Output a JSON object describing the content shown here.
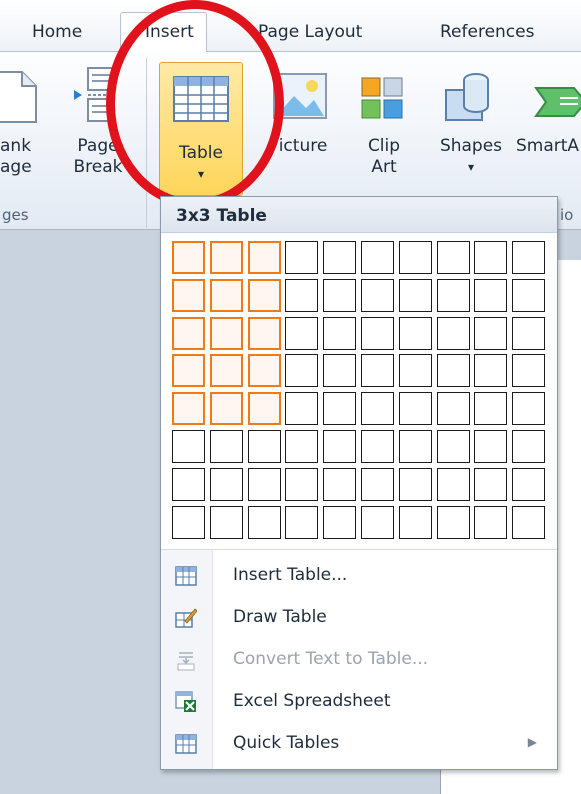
{
  "tabs": [
    {
      "label": "Home"
    },
    {
      "label": "Insert"
    },
    {
      "label": "Page Layout"
    },
    {
      "label": "References"
    }
  ],
  "ribbon": {
    "blank_page": {
      "line1": "ank",
      "line2": "age"
    },
    "page_break": {
      "line1": "Page",
      "line2": "Break"
    },
    "table": {
      "label": "Table",
      "arrow": "▾"
    },
    "picture": {
      "label": "icture"
    },
    "clip_art": {
      "line1": "Clip",
      "line2": "Art"
    },
    "shapes": {
      "label": "Shapes",
      "arrow": "▾"
    },
    "smartart": {
      "label": "SmartA"
    },
    "group_pages": "ges",
    "group_illustrations": "io"
  },
  "dropdown": {
    "header": "3x3 Table",
    "grid": {
      "columns": 10,
      "rows": 8,
      "selected_columns": 3,
      "selected_rows": 5
    },
    "menu": [
      {
        "label": "Insert Table...",
        "icon": "insert-table-icon",
        "disabled": false,
        "submenu": false
      },
      {
        "label": "Draw Table",
        "icon": "draw-table-icon",
        "disabled": false,
        "submenu": false
      },
      {
        "label": "Convert Text to Table...",
        "icon": "convert-text-icon",
        "disabled": true,
        "submenu": false
      },
      {
        "label": "Excel Spreadsheet",
        "icon": "excel-icon",
        "disabled": false,
        "submenu": false
      },
      {
        "label": "Quick Tables",
        "icon": "quick-tables-icon",
        "disabled": false,
        "submenu": true
      }
    ],
    "submenu_arrow": "▶"
  },
  "colors": {
    "annotation": "#e0121b",
    "grid_highlight": "#f07a18",
    "table_button": "#ffd55a"
  }
}
